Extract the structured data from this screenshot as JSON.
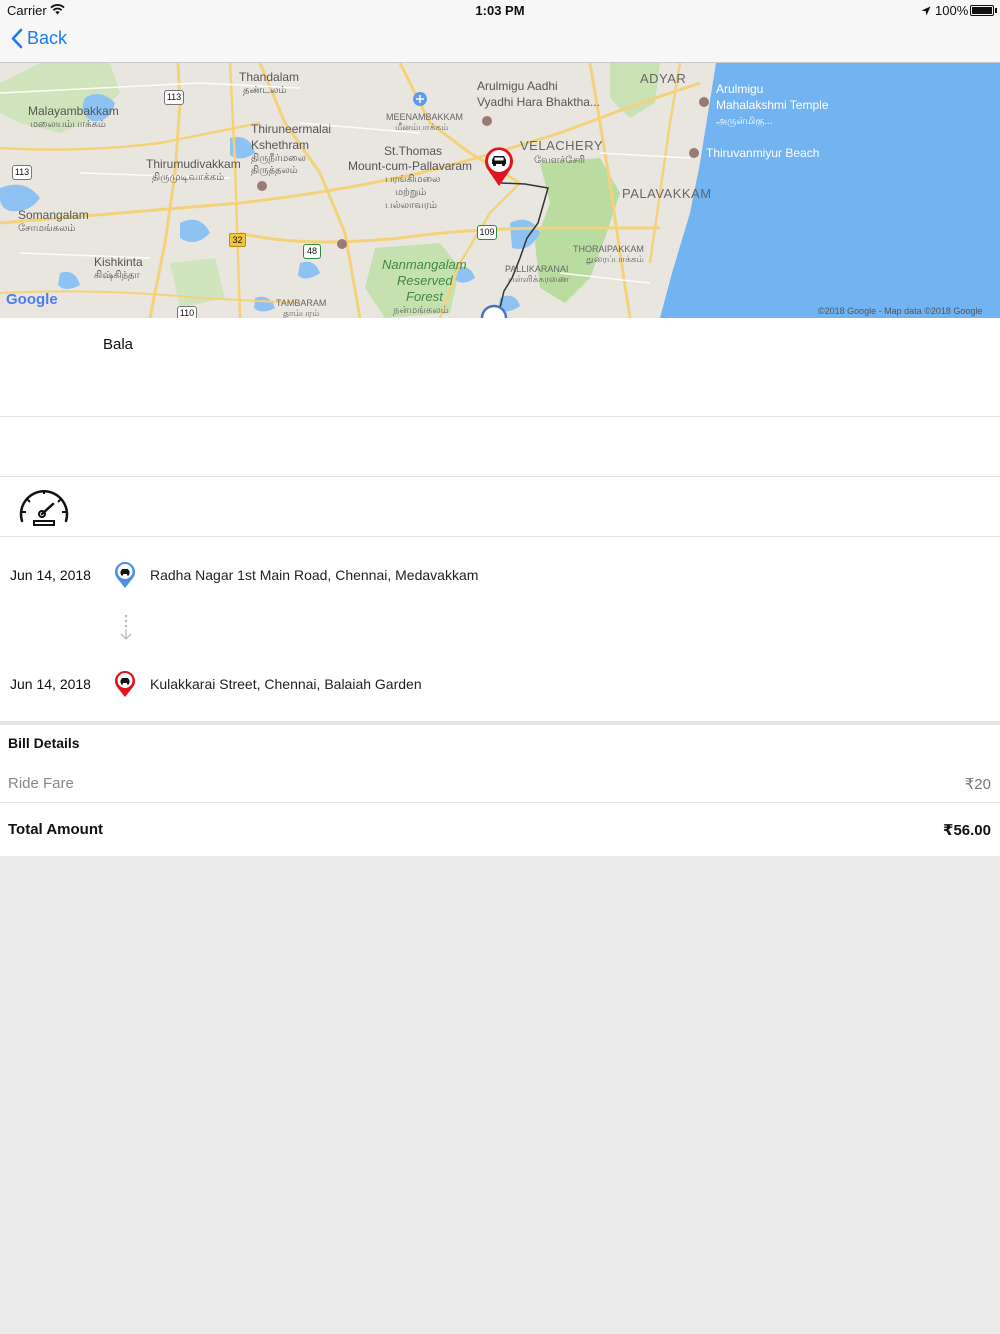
{
  "status_bar": {
    "carrier": "Carrier",
    "time": "1:03 PM",
    "battery": "100%"
  },
  "nav": {
    "back_label": "Back"
  },
  "map": {
    "labels": {
      "thandalam": "Thandalam",
      "thandalam_ta": "தண்டலம்",
      "malayambakkam": "Malayambakkam",
      "malayambakkam_ta": "மலையம்பாக்கம்",
      "thiruneermalai": "Thiruneermalai",
      "kshethram": "Kshethram",
      "thiruneermalai_ta": "திருநீர்மலை",
      "thirutthalam_ta": "திருத்தலம்",
      "thirumudivakkam": "Thirumudivakkam",
      "thirumudivakkam_ta": "திருமுடிவாக்கம்",
      "somangalam": "Somangalam",
      "somangalam_ta": "சோமங்கலம்",
      "kishkinta": "Kishkinta",
      "kishkinta_ta": "கிஷ்கிந்தா",
      "meenambakkam": "MEENAMBAKKAM",
      "meenambakkam_ta": "மீனம்பாக்கம்",
      "st_thomas": "St.Thomas",
      "mount_cum": "Mount-cum-Pallavaram",
      "st_thomas_ta1": "பரங்கிமலை",
      "st_thomas_ta2": "மற்றும்",
      "st_thomas_ta3": "பல்லாவரம்",
      "arulmigu_aadhi": "Arulmigu Aadhi",
      "vyadhi": "Vyadhi Hara Bhaktha...",
      "velachery": "VELACHERY",
      "velachery_ta": "வேளச்சேரி",
      "adyar": "ADYAR",
      "arulmigu": "Arulmigu",
      "mahalakshmi": "Mahalakshmi Temple",
      "arulmigu_ta": "அருள்மிகு...",
      "thiruvanmiyur": "Thiruvanmiyur Beach",
      "palavakkam": "PALAVAKKAM",
      "thoraipakkam": "THORAIPAKKAM",
      "thoraipakkam_ta": "துரைப்பாக்கம்",
      "pallikaranai": "PALLIKARANAI",
      "pallikaranai_ta": "பள்ளிக்கரணை",
      "nanmangalam": "Nanmangalam",
      "reserved": "Reserved",
      "forest": "Forest",
      "nanmangalam_ta": "நன்மங்கலம்",
      "tambaram": "TAMBARAM",
      "tambaram_ta": "தாம்பரம்"
    },
    "shields": {
      "r113a": "113",
      "r113b": "113",
      "r32": "32",
      "r48": "48",
      "r109": "109",
      "r110": "110"
    },
    "google": "Google",
    "attribution": "©2018 Google - Map data ©2018 Google"
  },
  "driver": {
    "name": "Bala"
  },
  "trip": {
    "pickup": {
      "date": "Jun 14, 2018",
      "address": "Radha Nagar 1st Main Road, Chennai, Medavakkam"
    },
    "dropoff": {
      "date": "Jun 14, 2018",
      "address": "Kulakkarai Street, Chennai, Balaiah Garden"
    }
  },
  "bill": {
    "title": "Bill Details",
    "ride_fare_label": "Ride Fare",
    "ride_fare_value": "₹20",
    "total_label": "Total Amount",
    "total_value": "₹56.00"
  },
  "colors": {
    "accent": "#1a7cf5",
    "pickup_pin": "#4a90e2",
    "dropoff_pin": "#e0141e",
    "sea": "#6fb0f0",
    "park": "#b9dca1"
  }
}
